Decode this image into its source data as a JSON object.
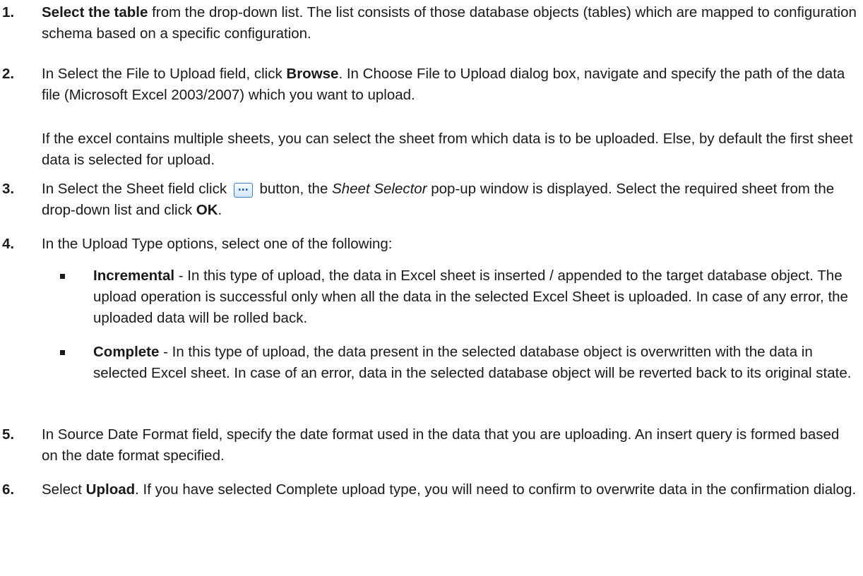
{
  "steps": [
    {
      "num": "1.",
      "bold": "Select the table",
      "text": " from the drop-down list. The list consists of those database objects (tables) which are mapped to configuration schema based on a specific configuration."
    },
    {
      "num": "2.",
      "pre": "In Select the File to Upload field, click ",
      "bold": "Browse",
      "post": ". In Choose File to Upload dialog box, navigate and specify the path of the data file (Microsoft Excel 2003/2007) which you want to upload.",
      "note": "If the excel contains multiple sheets, you can select the sheet from which data is to be uploaded. Else, by default the first sheet data is selected for upload."
    },
    {
      "num": "3.",
      "pre": "In Select the Sheet field click ",
      "button_glyph": "...",
      "mid": " button, the ",
      "italic": "Sheet Selector",
      "post": " pop-up window is displayed. Select the required sheet from the drop-down list and click ",
      "bold": "OK",
      "end": "."
    },
    {
      "num": "4.",
      "text": "In the Upload Type options, select one of the following:",
      "options": [
        {
          "bold": "Incremental",
          "text": " - In this type of upload, the data in Excel sheet is inserted / appended to the target database object. The upload operation is successful only when all the data in the selected Excel Sheet is uploaded. In case of any error, the uploaded data will be rolled back."
        },
        {
          "bold": "Complete",
          "text": " - In this type of upload, the data present in the selected database object is overwritten with the data in selected Excel sheet. In case of an error, data in the selected database object will be reverted back to its original state."
        }
      ]
    },
    {
      "num": "5.",
      "text": "In Source Date Format field, specify the date format used in the data that you are uploading. An insert query is formed based on the date format specified."
    },
    {
      "num": "6.",
      "pre": "Select ",
      "bold": "Upload",
      "post": ". If you have selected Complete upload type, you will need to confirm to overwrite data in the confirmation dialog."
    }
  ]
}
